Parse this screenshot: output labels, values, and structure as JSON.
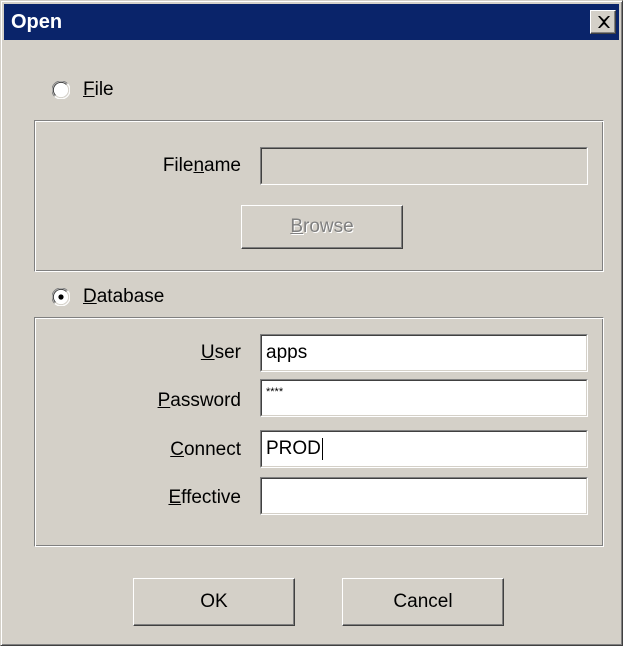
{
  "window": {
    "title": "Open"
  },
  "mode": {
    "selected": "Database",
    "file": {
      "label_prefix": "",
      "label_accel": "F",
      "label_rest": "ile",
      "selected": false
    },
    "database": {
      "label_prefix": "",
      "label_accel": "D",
      "label_rest": "atabase",
      "selected": true
    }
  },
  "file_group": {
    "filename": {
      "label_prefix": "File",
      "label_accel": "n",
      "label_rest": "ame",
      "value": "",
      "enabled": false
    },
    "browse_button": {
      "label_prefix": "",
      "label_accel": "B",
      "label_rest": "rowse",
      "enabled": false
    }
  },
  "db_group": {
    "user": {
      "label_prefix": "",
      "label_accel": "U",
      "label_rest": "ser",
      "value": "apps"
    },
    "password": {
      "label_prefix": "",
      "label_accel": "P",
      "label_rest": "assword",
      "value": "****"
    },
    "connect": {
      "label_prefix": "",
      "label_accel": "C",
      "label_rest": "onnect",
      "value": "PROD"
    },
    "effective": {
      "label_prefix": "",
      "label_accel": "E",
      "label_rest": "ffective",
      "value": ""
    }
  },
  "buttons": {
    "ok": "OK",
    "cancel": "Cancel"
  },
  "colors": {
    "titlebar": "#0a246a",
    "face": "#d4d0c8",
    "disabled_text": "#808080"
  },
  "icons": {
    "close": "close-icon",
    "radio": "radio-button"
  }
}
